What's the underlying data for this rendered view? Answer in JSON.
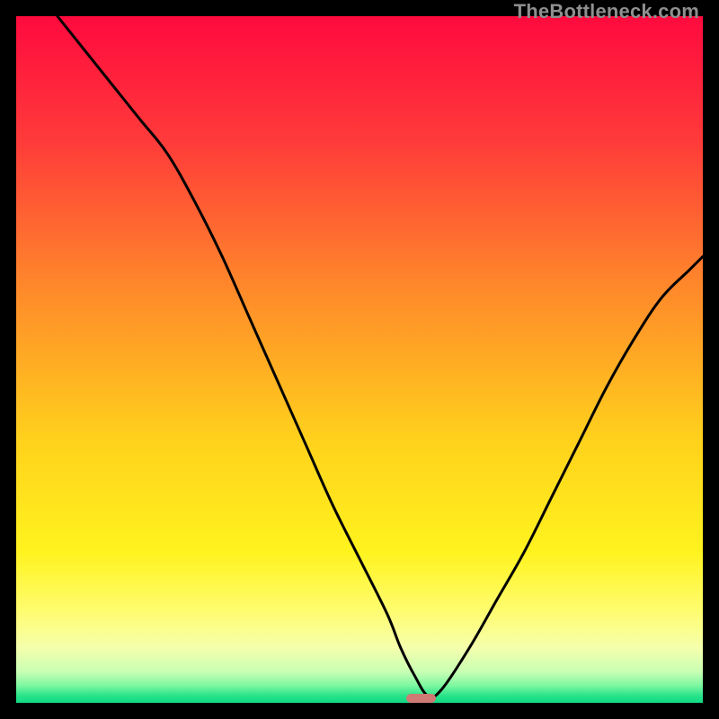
{
  "watermark": "TheBottleneck.com",
  "chart_data": {
    "type": "line",
    "title": "",
    "xlabel": "",
    "ylabel": "",
    "xlim": [
      0,
      100
    ],
    "ylim": [
      0,
      100
    ],
    "grid": false,
    "legend": false,
    "series": [
      {
        "name": "bottleneck-curve",
        "x": [
          6,
          10,
          14,
          18,
          22,
          26,
          30,
          34,
          38,
          42,
          46,
          50,
          54,
          56,
          58,
          60,
          62,
          66,
          70,
          74,
          78,
          82,
          86,
          90,
          94,
          98,
          100
        ],
        "values": [
          100,
          95,
          90,
          85,
          80,
          73,
          65,
          56,
          47,
          38,
          29,
          21,
          13,
          8,
          4,
          1,
          2,
          8,
          15,
          22,
          30,
          38,
          46,
          53,
          59,
          63,
          65
        ]
      }
    ],
    "marker": {
      "x_center": 59,
      "width_pct": 4.3
    },
    "background_gradient": {
      "stops": [
        {
          "pos": 0.0,
          "color": "#ff0a3e"
        },
        {
          "pos": 0.18,
          "color": "#ff3a3a"
        },
        {
          "pos": 0.4,
          "color": "#ff8a2a"
        },
        {
          "pos": 0.62,
          "color": "#ffd21c"
        },
        {
          "pos": 0.78,
          "color": "#fff31e"
        },
        {
          "pos": 0.865,
          "color": "#fffc6e"
        },
        {
          "pos": 0.92,
          "color": "#f5ffac"
        },
        {
          "pos": 0.955,
          "color": "#c8ffb4"
        },
        {
          "pos": 0.975,
          "color": "#7cf7a0"
        },
        {
          "pos": 0.99,
          "color": "#26e38a"
        },
        {
          "pos": 1.0,
          "color": "#11d984"
        }
      ]
    }
  }
}
